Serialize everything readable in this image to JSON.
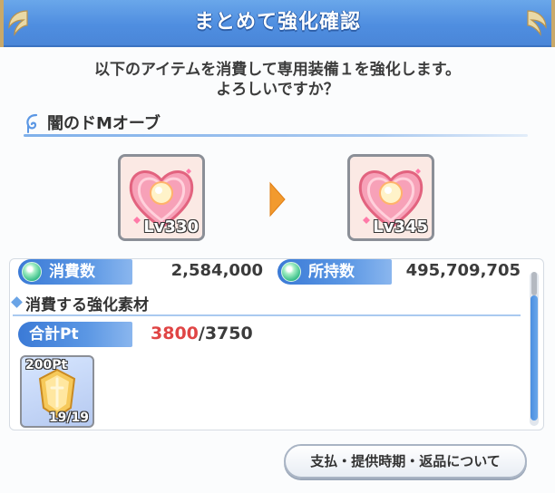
{
  "dialog": {
    "title": "まとめて強化確認",
    "message_line1": "以下のアイテムを消費して専用装備１を強化します。",
    "message_line2": "よろしいですか？"
  },
  "item": {
    "name": "闇のドMオーブ",
    "level_before": "Lv330",
    "level_after": "Lv345"
  },
  "cost": {
    "consume_label": "消費数",
    "consume_value": "2,584,000",
    "owned_label": "所持数",
    "owned_value": "495,709,705"
  },
  "materials": {
    "section_title": "消費する強化素材",
    "total_label": "合計Pt",
    "total_current": "3800",
    "total_required": "/3750",
    "items": [
      {
        "pt": "200Pt",
        "count": "19/19"
      }
    ]
  },
  "buttons": {
    "info": "支払・提供時期・返品について"
  },
  "colors": {
    "title_blue": "#4f8ee0",
    "exceed_red": "#e04545",
    "arrow_orange": "#f29a2e"
  }
}
